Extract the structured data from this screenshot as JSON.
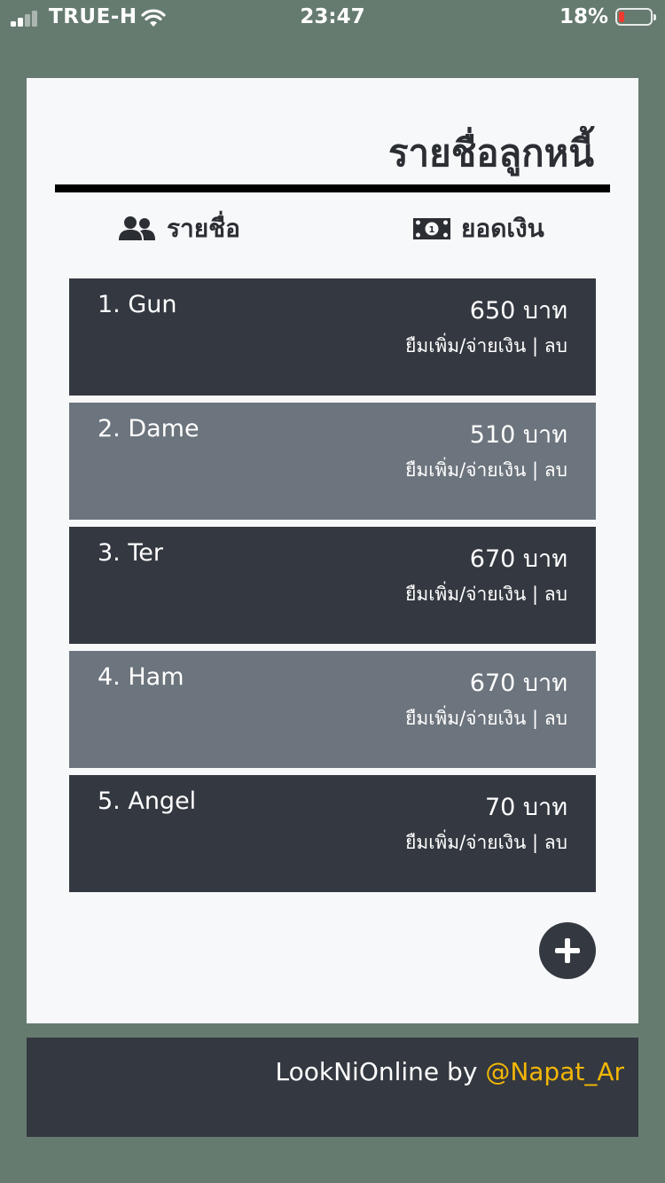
{
  "status_bar": {
    "carrier": "TRUE-H",
    "time": "23:47",
    "battery": "18%",
    "battery_level": 0.18
  },
  "header": {
    "title": "รายชื่อลูกหนี้"
  },
  "columns": {
    "names_label": "รายชื่อ",
    "amount_label": "ยอดเงิน",
    "names_icon": "users-icon",
    "amount_icon": "money-bill-icon"
  },
  "debtors": [
    {
      "name": "1. Gun",
      "amount": "650 บาท",
      "actions": "ยืมเพิ่ม/จ่ายเงิน | ลบ"
    },
    {
      "name": "2. Dame",
      "amount": "510 บาท",
      "actions": "ยืมเพิ่ม/จ่ายเงิน | ลบ"
    },
    {
      "name": "3.  Ter",
      "amount": "670 บาท",
      "actions": "ยืมเพิ่ม/จ่ายเงิน | ลบ"
    },
    {
      "name": "4.  Ham",
      "amount": "670 บาท",
      "actions": "ยืมเพิ่ม/จ่ายเงิน | ลบ"
    },
    {
      "name": "5.  Angel",
      "amount": "70 บาท",
      "actions": "ยืมเพิ่ม/จ่ายเงิน | ลบ"
    }
  ],
  "add_icon": "plus-icon",
  "footer": {
    "app_name": "LookNiOnline by ",
    "author": "@Napat_Ar"
  },
  "colors": {
    "background": "#667b70",
    "row_dark": "#343840",
    "row_light": "#6c747d",
    "author_accent": "#f2b705",
    "battery_low": "#f03b2f"
  }
}
